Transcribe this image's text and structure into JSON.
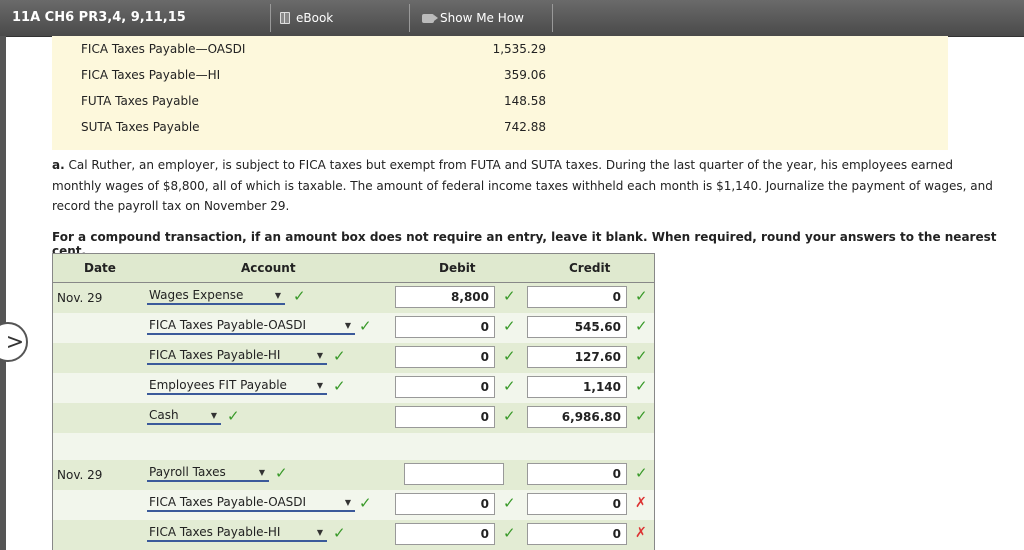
{
  "header": {
    "title": "11A CH6 PR3,4, 9,11,15",
    "ebook_label": "eBook",
    "show_me_how_label": "Show Me How"
  },
  "summary": [
    {
      "label": "FICA Taxes Payable—OASDI",
      "value": "1,535.29"
    },
    {
      "label": "FICA Taxes Payable—HI",
      "value": "359.06"
    },
    {
      "label": "FUTA Taxes Payable",
      "value": "148.58"
    },
    {
      "label": "SUTA Taxes Payable",
      "value": "742.88"
    }
  ],
  "question": {
    "prefix": "a.",
    "text": "Cal Ruther, an employer, is subject to FICA taxes but exempt from FUTA and SUTA taxes. During the last quarter of the year, his employees earned monthly wages of $8,800, all of which is taxable. The amount of federal income taxes withheld each month is $1,140. Journalize the payment of wages, and record the payroll tax on November 29.",
    "instruction": "For a compound transaction, if an amount box does not require an entry, leave it blank. When required, round your answers to the nearest cent."
  },
  "journal": {
    "headers": {
      "date": "Date",
      "account": "Account",
      "debit": "Debit",
      "credit": "Credit"
    },
    "entry1": {
      "date": "Nov. 29",
      "rows": [
        {
          "account": "Wages Expense",
          "debit": "8,800",
          "credit": "0",
          "credit_status": "correct"
        },
        {
          "account": "FICA Taxes Payable-OASDI",
          "debit": "0",
          "credit": "545.60",
          "credit_status": "correct"
        },
        {
          "account": "FICA Taxes Payable-HI",
          "debit": "0",
          "credit": "127.60",
          "credit_status": "correct"
        },
        {
          "account": "Employees FIT Payable",
          "debit": "0",
          "credit": "1,140",
          "credit_status": "correct"
        },
        {
          "account": "Cash",
          "debit": "0",
          "credit": "6,986.80",
          "credit_status": "correct"
        }
      ]
    },
    "entry2": {
      "date": "Nov. 29",
      "rows": [
        {
          "account": "Payroll Taxes",
          "debit": "",
          "credit": "0",
          "credit_status": "correct"
        },
        {
          "account": "FICA Taxes Payable-OASDI",
          "debit": "0",
          "credit": "0",
          "credit_status": "incorrect"
        },
        {
          "account": "FICA Taxes Payable-HI",
          "debit": "0",
          "credit": "0",
          "credit_status": "incorrect"
        }
      ]
    }
  },
  "icons": {
    "check": "check-icon",
    "x": "x-icon",
    "book": "book-icon",
    "video": "video-icon",
    "nav": "chevron-right-icon"
  },
  "colors": {
    "correct": "#3a9a2a",
    "incorrect": "#d33333",
    "header_bg": "#dfe9cf",
    "summary_bg": "#fdf8dc"
  }
}
